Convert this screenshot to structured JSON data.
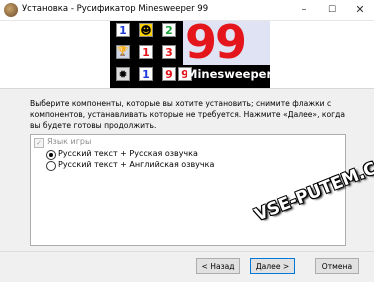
{
  "window": {
    "title": "Установка - Русификатор Minesweeper 99",
    "controls": {
      "minimize": "–",
      "maximize": "☐",
      "close": "✕"
    }
  },
  "banner": {
    "logo_number": "99",
    "logo_text": "Minesweeper",
    "tiles": [
      "1",
      "☻",
      "2",
      "🏆",
      "1",
      "3",
      "✹",
      "1",
      "9",
      "9"
    ]
  },
  "main": {
    "description": "Выберите компоненты, которые вы хотите установить; снимите флажки с компонентов, устанавливать которые не требуется. Нажмите «Далее», когда вы будете готовы продолжить.",
    "components": {
      "group_label": "Язык игры",
      "group_checked": true,
      "options": [
        {
          "label": "Русский текст + Русская озвучка",
          "selected": true
        },
        {
          "label": "Русский текст + Английская озвучка",
          "selected": false
        }
      ]
    }
  },
  "watermark": "VSE-PUTEM.COM",
  "footer": {
    "back_label": "< Назад",
    "next_label": "Далее >",
    "cancel_label": "Отмена"
  }
}
